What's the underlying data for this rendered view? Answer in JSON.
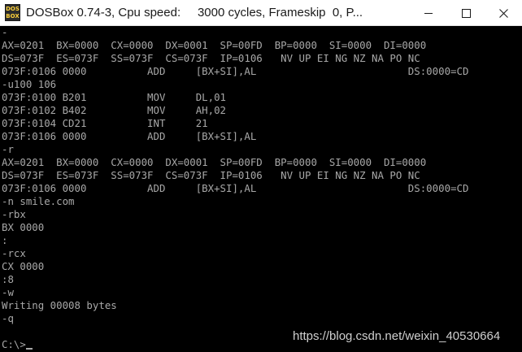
{
  "window": {
    "title": "DOSBox 0.74-3, Cpu speed:     3000 cycles, Frameskip  0, P...",
    "icon_name": "dosbox-icon",
    "icon_text_top": "DOS",
    "icon_text_bottom": "BOX",
    "minimize_glyph": "—",
    "maximize_glyph": "□",
    "close_glyph": "✕"
  },
  "console": {
    "lines": [
      "-",
      "AX=0201  BX=0000  CX=0000  DX=0001  SP=00FD  BP=0000  SI=0000  DI=0000",
      "DS=073F  ES=073F  SS=073F  CS=073F  IP=0106   NV UP EI NG NZ NA PO NC",
      "073F:0106 0000          ADD     [BX+SI],AL                         DS:0000=CD",
      "-u100 106",
      "073F:0100 B201          MOV     DL,01",
      "073F:0102 B402          MOV     AH,02",
      "073F:0104 CD21          INT     21",
      "073F:0106 0000          ADD     [BX+SI],AL",
      "-r",
      "AX=0201  BX=0000  CX=0000  DX=0001  SP=00FD  BP=0000  SI=0000  DI=0000",
      "DS=073F  ES=073F  SS=073F  CS=073F  IP=0106   NV UP EI NG NZ NA PO NC",
      "073F:0106 0000          ADD     [BX+SI],AL                         DS:0000=CD",
      "-n smile.com",
      "-rbx",
      "BX 0000",
      ":",
      "-rcx",
      "CX 0000",
      ":8",
      "-w",
      "Writing 00008 bytes",
      "-q",
      "",
      "C:\\>"
    ],
    "text_color": "#a8a8a8",
    "background_color": "#000000"
  },
  "watermark": {
    "text": "https://blog.csdn.net/weixin_40530664"
  }
}
